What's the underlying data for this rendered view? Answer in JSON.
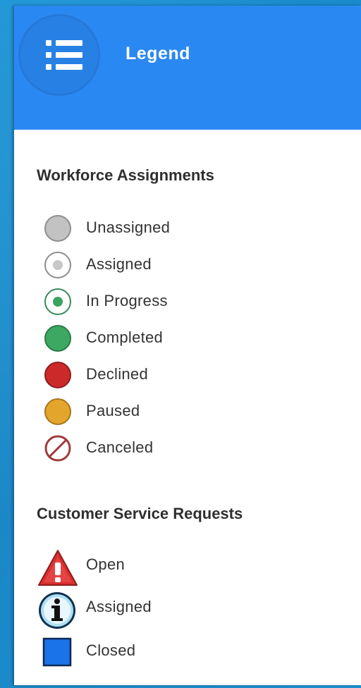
{
  "header": {
    "title": "Legend",
    "menu_icon": "hamburger-list-icon",
    "color": "#2a88f2"
  },
  "workforce": {
    "heading": "Workforce Assignments",
    "items": [
      {
        "label": "Unassigned",
        "icon": "circle-gray-icon",
        "color": "#c0c0c0"
      },
      {
        "label": "Assigned",
        "icon": "circle-white-gray-dot-icon",
        "color": "#c8c8c8"
      },
      {
        "label": "In Progress",
        "icon": "circle-white-green-dot-icon",
        "color": "#3aa35e"
      },
      {
        "label": "Completed",
        "icon": "circle-green-icon",
        "color": "#3aa35e"
      },
      {
        "label": "Declined",
        "icon": "circle-red-icon",
        "color": "#cc2a2a"
      },
      {
        "label": "Paused",
        "icon": "circle-yellow-icon",
        "color": "#e4a52c"
      },
      {
        "label": "Canceled",
        "icon": "canceled-slash-icon",
        "color": "#a03a3a"
      }
    ]
  },
  "requests": {
    "heading": "Customer Service Requests",
    "items": [
      {
        "label": "Open",
        "icon": "warning-triangle-icon",
        "color": "#d92f2f"
      },
      {
        "label": "Assigned",
        "icon": "info-circle-icon",
        "color": "#3a9fd8"
      },
      {
        "label": "Closed",
        "icon": "blue-square-icon",
        "color": "#1a73e8"
      }
    ]
  }
}
